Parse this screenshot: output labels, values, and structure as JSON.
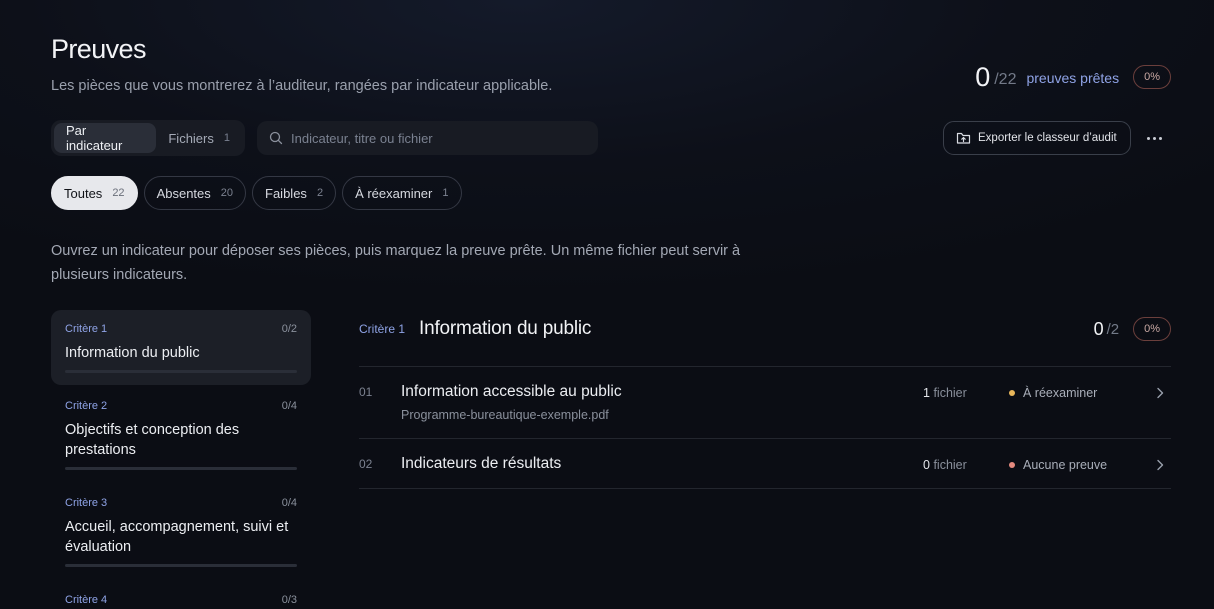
{
  "header": {
    "title": "Preuves",
    "subtitle": "Les pièces que vous montrerez à l’auditeur, rangées par indicateur applicable."
  },
  "summary": {
    "ready": "0",
    "total": "/22",
    "label": "preuves prêtes",
    "percent": "0%"
  },
  "view_toggle": {
    "by_indicator": "Par indicateur",
    "files": "Fichiers",
    "files_count": "1",
    "active": "by_indicator"
  },
  "search": {
    "placeholder": "Indicateur, titre ou fichier",
    "value": ""
  },
  "actions": {
    "export_label": "Exporter le classeur d’audit"
  },
  "filters": [
    {
      "label": "Toutes",
      "count": "22",
      "active": true
    },
    {
      "label": "Absentes",
      "count": "20",
      "active": false
    },
    {
      "label": "Faibles",
      "count": "2",
      "active": false
    },
    {
      "label": "À réexaminer",
      "count": "1",
      "active": false
    }
  ],
  "helper_text": "Ouvrez un indicateur pour déposer ses pièces, puis marquez la preuve prête. Un même fichier peut servir à plusieurs indicateurs.",
  "criteria": [
    {
      "label": "Critère 1",
      "count": "0/2",
      "title": "Information du public",
      "progress": 0,
      "active": true
    },
    {
      "label": "Critère 2",
      "count": "0/4",
      "title": "Objectifs et conception des prestations",
      "progress": 0,
      "active": false
    },
    {
      "label": "Critère 3",
      "count": "0/4",
      "title": "Accueil, accompagnement, suivi et évaluation",
      "progress": 0,
      "active": false
    },
    {
      "label": "Critère 4",
      "count": "0/3",
      "title": "",
      "progress": 0,
      "active": false
    }
  ],
  "detail": {
    "criterion_label": "Critère 1",
    "title": "Information du public",
    "ready": "0",
    "total": "/2",
    "percent": "0%",
    "indicators": [
      {
        "num": "01",
        "title": "Information accessible au public",
        "file": "Programme-bureautique-exemple.pdf",
        "files_count": "1",
        "files_label": "fichier",
        "status": "À réexaminer",
        "status_color": "#e8b65a"
      },
      {
        "num": "02",
        "title": "Indicateurs de résultats",
        "file": "",
        "files_count": "0",
        "files_label": "fichier",
        "status": "Aucune preuve",
        "status_color": "#e58a7f"
      }
    ]
  },
  "colors": {
    "accent": "#8fa3e6",
    "background": "#0d1019"
  },
  "icons": [
    "search-icon",
    "export-icon",
    "more-icon",
    "chevron-right-icon"
  ]
}
